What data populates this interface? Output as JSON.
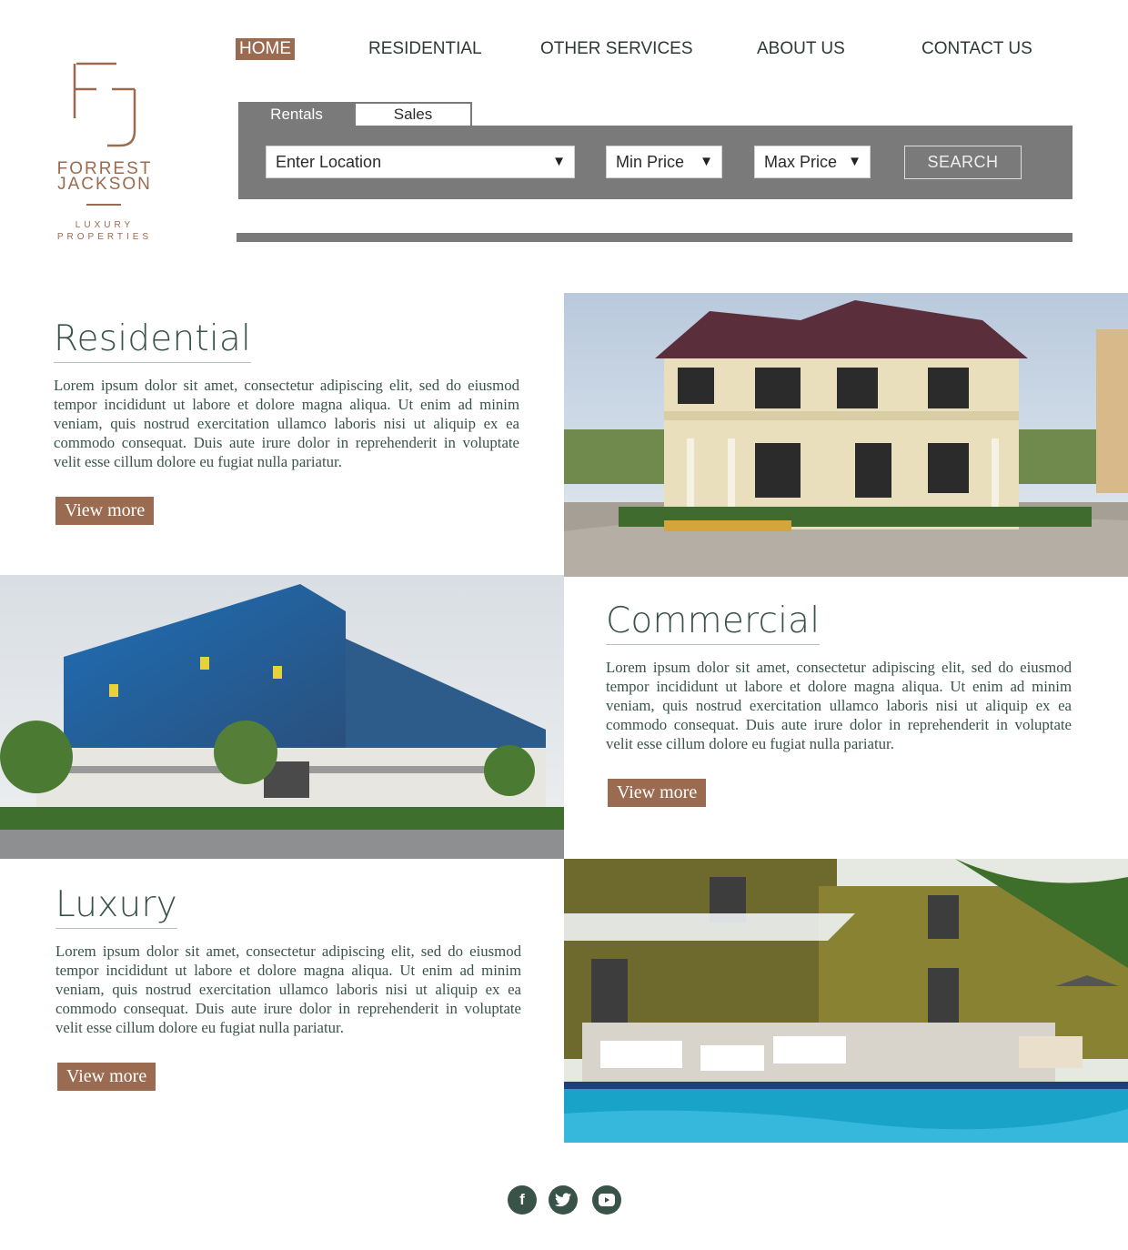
{
  "brand": {
    "name_line1": "FORREST",
    "name_line2": "JACKSON",
    "tagline_line1": "LUXURY",
    "tagline_line2": "PROPERTIES",
    "color": "#9a6b50"
  },
  "nav": {
    "items": [
      {
        "label": "HOME",
        "active": true
      },
      {
        "label": "RESIDENTIAL"
      },
      {
        "label": "OTHER SERVICES"
      },
      {
        "label": "ABOUT US"
      },
      {
        "label": "CONTACT US"
      }
    ]
  },
  "search": {
    "tabs": [
      {
        "label": "Rentals",
        "selected": true
      },
      {
        "label": "Sales"
      }
    ],
    "location": "Enter Location",
    "min_price": "Min Price",
    "max_price": "Max Price",
    "button": "SEARCH",
    "arrow": "▼"
  },
  "sections": [
    {
      "title": "Residential",
      "body": "Lorem ipsum dolor sit amet, consectetur adipiscing elit, sed do eiusmod tempor incididunt ut labore et dolore magna aliqua. Ut enim ad minim veniam, quis nostrud exercitation ullamco laboris nisi ut aliquip ex ea commodo consequat. Duis aute irure dolor in reprehenderit in voluptate velit esse cillum dolore eu fugiat nulla pariatur.",
      "button": "View more"
    },
    {
      "title": "Commercial",
      "body": "Lorem ipsum dolor sit amet, consectetur adipiscing elit, sed do eiusmod tempor incididunt ut labore et dolore magna aliqua. Ut enim ad minim veniam, quis nostrud exercitation ullamco laboris nisi ut aliquip ex ea commodo consequat. Duis aute irure dolor in reprehenderit in voluptate velit esse cillum dolore eu fugiat nulla pariatur.",
      "button": "View more"
    },
    {
      "title": "Luxury",
      "body": "Lorem ipsum dolor sit amet, consectetur adipiscing elit, sed do eiusmod tempor incididunt ut labore et dolore magna aliqua. Ut enim ad minim veniam, quis nostrud exercitation ullamco laboris nisi ut aliquip ex ea commodo consequat. Duis aute irure dolor in reprehenderit in voluptate velit esse cillum dolore eu fugiat nulla pariatur.",
      "button": "View more"
    }
  ],
  "social": [
    {
      "icon": "facebook-icon",
      "glyph": "f"
    },
    {
      "icon": "twitter-icon",
      "glyph": "🐦"
    },
    {
      "icon": "youtube-icon",
      "glyph": "▶"
    }
  ],
  "colors": {
    "accent": "#9a6b50",
    "panel": "#7a7a7a",
    "text": "#3a5349"
  }
}
